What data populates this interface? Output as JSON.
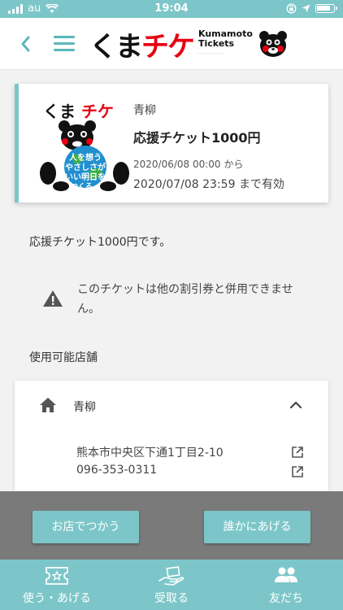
{
  "status_bar": {
    "carrier": "au",
    "time": "19:04"
  },
  "header": {
    "logo_main": "くま",
    "logo_accent": "チケ",
    "logo_sub_1": "Kumamoto",
    "logo_sub_2": "Tickets"
  },
  "ticket": {
    "image_word_1": "くま",
    "image_word_2": "チケ",
    "image_slogan": "人を想う やさしさが いい明日を つくる。",
    "store": "青柳",
    "name": "応援チケット1000円",
    "valid_from": "2020/06/08 00:00 から",
    "valid_until": "2020/07/08 23:59 まで有効"
  },
  "description": "応援チケット1000円です。",
  "warning": "このチケットは他の割引券と併用できません。",
  "stores_section_title": "使用可能店舗",
  "store": {
    "name": "青柳",
    "address": "熊本市中央区下通1丁目2-10",
    "phone": "096-353-0311"
  },
  "actions": {
    "use_label": "お店でつかう",
    "give_label": "誰かにあげる"
  },
  "bottom_nav": [
    {
      "label": "使う・あげる"
    },
    {
      "label": "受取る"
    },
    {
      "label": "友だち"
    }
  ],
  "colors": {
    "accent": "#7cc6c9",
    "brand_red": "#e60012",
    "overlay": "#7a7a7a"
  }
}
